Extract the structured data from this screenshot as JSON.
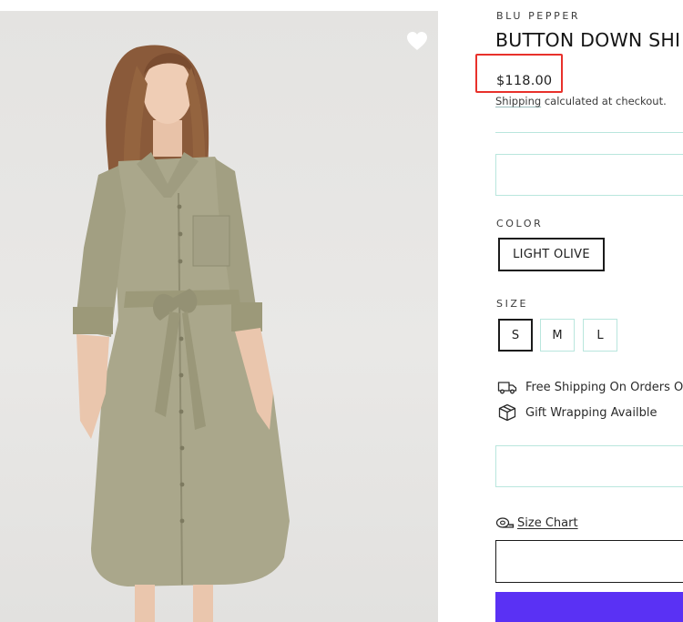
{
  "product": {
    "vendor": "BLU PEPPER",
    "title": "BUTTON DOWN SHI",
    "price": "$118.00",
    "shipping_link": "Shipping",
    "shipping_rest": " calculated at checkout."
  },
  "options": {
    "color_label": "COLOR",
    "color_value": "LIGHT OLIVE",
    "size_label": "SIZE",
    "sizes": [
      "S",
      "M",
      "L"
    ],
    "selected_size": "S"
  },
  "perks": {
    "free_shipping": "Free Shipping On Orders O",
    "gift_wrapping": "Gift Wrapping Availble"
  },
  "size_chart_label": "Size Chart",
  "icons": {
    "wishlist": "heart-icon",
    "shipping": "truck-icon",
    "gift": "box-icon",
    "size_chart": "tape-measure-icon"
  },
  "colors": {
    "highlight": "#e8312b",
    "accent_border": "#b9e6dd",
    "buy_button": "#5a31f4",
    "dress": "#a8a68a"
  }
}
